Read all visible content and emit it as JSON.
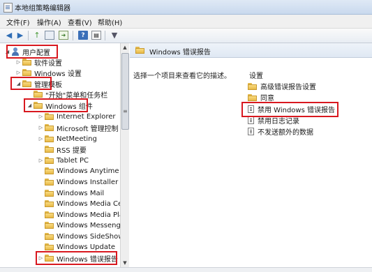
{
  "window": {
    "title": "本地组策略编辑器"
  },
  "menu": [
    {
      "label": "文件(F)"
    },
    {
      "label": "操作(A)"
    },
    {
      "label": "查看(V)"
    },
    {
      "label": "帮助(H)"
    }
  ],
  "toolbar": {
    "icons": [
      "back-icon",
      "forward-icon",
      "up-folder-icon",
      "show-hide-tree-icon",
      "export-list-icon",
      "help-icon",
      "properties-icon",
      "filter-icon"
    ]
  },
  "tree": {
    "items": [
      {
        "label": "用户配置",
        "expanded": true,
        "highlighted": true
      },
      {
        "label": "软件设置",
        "expanded": false,
        "highlighted": false
      },
      {
        "label": "Windows 设置",
        "expanded": false,
        "highlighted": false
      },
      {
        "label": "管理模板",
        "expanded": true,
        "highlighted": true
      },
      {
        "label": "\"开始\"菜单和任务栏",
        "expanded": false,
        "highlighted": false
      },
      {
        "label": "Windows 组件",
        "expanded": true,
        "highlighted": true
      },
      {
        "label": "Internet Explorer",
        "expanded": false,
        "highlighted": false
      },
      {
        "label": "Microsoft 管理控制",
        "expanded": false,
        "highlighted": false
      },
      {
        "label": "NetMeeting",
        "expanded": false,
        "highlighted": false
      },
      {
        "label": "RSS 提要",
        "expanded": false,
        "highlighted": false
      },
      {
        "label": "Tablet PC",
        "expanded": false,
        "highlighted": false
      },
      {
        "label": "Windows Anytime U",
        "expanded": false,
        "highlighted": false
      },
      {
        "label": "Windows Installer",
        "expanded": false,
        "highlighted": false
      },
      {
        "label": "Windows Mail",
        "expanded": false,
        "highlighted": false
      },
      {
        "label": "Windows Media Ce",
        "expanded": false,
        "highlighted": false
      },
      {
        "label": "Windows Media Pla",
        "expanded": false,
        "highlighted": false
      },
      {
        "label": "Windows Messeng",
        "expanded": false,
        "highlighted": false
      },
      {
        "label": "Windows SideShow",
        "expanded": false,
        "highlighted": false
      },
      {
        "label": "Windows Update",
        "expanded": false,
        "highlighted": false
      },
      {
        "label": "Windows 错误报告",
        "expanded": false,
        "highlighted": true
      }
    ]
  },
  "panel": {
    "header": "Windows 错误报告",
    "description": "选择一个项目来查看它的描述。",
    "column_header": "设置",
    "items": [
      {
        "label": "高级错误报告设置",
        "type": "folder",
        "highlighted": false
      },
      {
        "label": "同意",
        "type": "folder",
        "highlighted": false
      },
      {
        "label": "禁用 Windows 错误报告",
        "type": "setting",
        "highlighted": true
      },
      {
        "label": "禁用日志记录",
        "type": "setting",
        "highlighted": false
      },
      {
        "label": "不发送额外的数据",
        "type": "setting",
        "highlighted": false
      }
    ]
  },
  "colors": {
    "highlight_border": "#d8181f",
    "folder": "#f2cc5e",
    "header_bg": "#dfe8f3"
  }
}
